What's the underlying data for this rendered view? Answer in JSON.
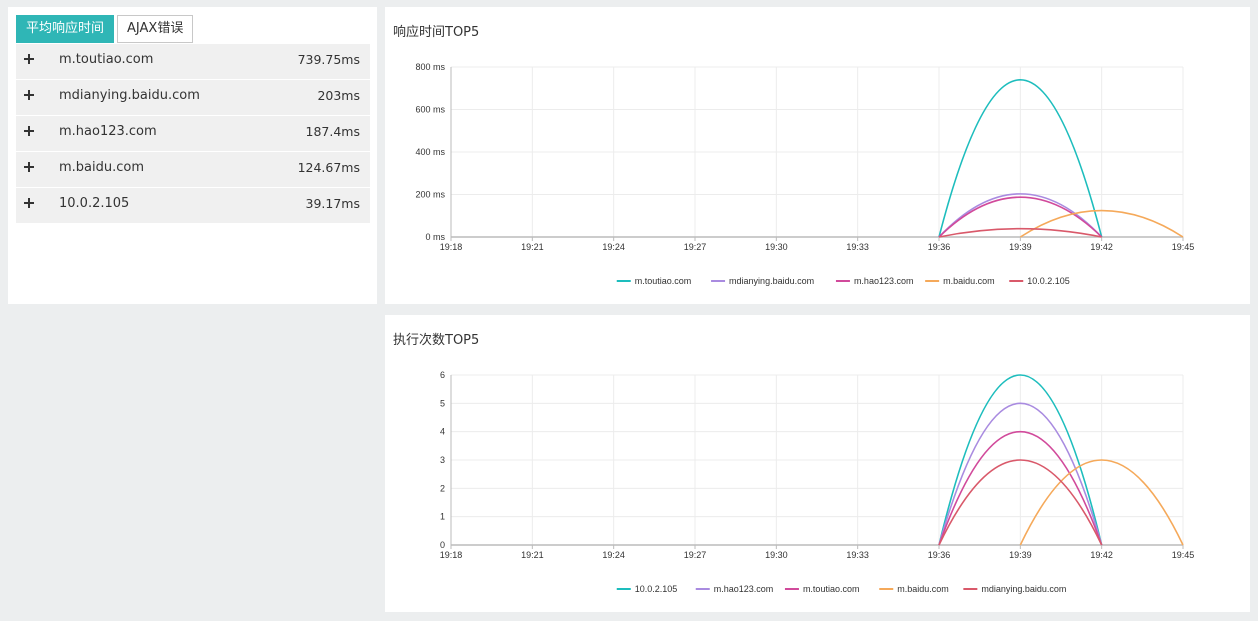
{
  "tabs": [
    {
      "label": "平均响应时间",
      "active": true
    },
    {
      "label": "AJAX错误",
      "active": false
    }
  ],
  "list": [
    {
      "host": "m.toutiao.com",
      "value": "739.75ms"
    },
    {
      "host": "mdianying.baidu.com",
      "value": "203ms"
    },
    {
      "host": "m.hao123.com",
      "value": "187.4ms"
    },
    {
      "host": "m.baidu.com",
      "value": "124.67ms"
    },
    {
      "host": "10.0.2.105",
      "value": "39.17ms"
    }
  ],
  "colors": {
    "teal": "#1dbdbd",
    "lavender": "#a98be0",
    "magenta": "#d14a9b",
    "orange": "#f5a95a",
    "red": "#d9596a"
  },
  "chart_data": [
    {
      "type": "line",
      "title": "响应时间TOP5",
      "x": [
        "19:18",
        "19:21",
        "19:24",
        "19:27",
        "19:30",
        "19:33",
        "19:36",
        "19:39",
        "19:42",
        "19:45"
      ],
      "y_ticks": [
        "0 ms",
        "200 ms",
        "400 ms",
        "600 ms",
        "800 ms"
      ],
      "ylim": [
        0,
        800
      ],
      "grid": true,
      "legend_position": "bottom",
      "series": [
        {
          "name": "m.toutiao.com",
          "color": "#1dbdbd",
          "points": [
            [
              "19:36",
              0
            ],
            [
              "19:39",
              739.75
            ],
            [
              "19:42",
              0
            ]
          ]
        },
        {
          "name": "mdianying.baidu.com",
          "color": "#a98be0",
          "points": [
            [
              "19:36",
              0
            ],
            [
              "19:39",
              203
            ],
            [
              "19:42",
              0
            ]
          ]
        },
        {
          "name": "m.hao123.com",
          "color": "#d14a9b",
          "points": [
            [
              "19:36",
              0
            ],
            [
              "19:39",
              187.4
            ],
            [
              "19:42",
              0
            ]
          ]
        },
        {
          "name": "m.baidu.com",
          "color": "#f5a95a",
          "points": [
            [
              "19:39",
              0
            ],
            [
              "19:42",
              124.67
            ],
            [
              "19:45",
              0
            ]
          ]
        },
        {
          "name": "10.0.2.105",
          "color": "#d9596a",
          "points": [
            [
              "19:36",
              0
            ],
            [
              "19:39",
              39.17
            ],
            [
              "19:42",
              0
            ]
          ]
        }
      ]
    },
    {
      "type": "line",
      "title": "执行次数TOP5",
      "x": [
        "19:18",
        "19:21",
        "19:24",
        "19:27",
        "19:30",
        "19:33",
        "19:36",
        "19:39",
        "19:42",
        "19:45"
      ],
      "y_ticks": [
        "0",
        "1",
        "2",
        "3",
        "4",
        "5",
        "6"
      ],
      "ylim": [
        0,
        6
      ],
      "grid": true,
      "legend_position": "bottom",
      "series": [
        {
          "name": "10.0.2.105",
          "color": "#1dbdbd",
          "points": [
            [
              "19:36",
              0
            ],
            [
              "19:39",
              6
            ],
            [
              "19:42",
              0
            ]
          ]
        },
        {
          "name": "m.hao123.com",
          "color": "#a98be0",
          "points": [
            [
              "19:36",
              0
            ],
            [
              "19:39",
              5
            ],
            [
              "19:42",
              0
            ]
          ]
        },
        {
          "name": "m.toutiao.com",
          "color": "#d14a9b",
          "points": [
            [
              "19:36",
              0
            ],
            [
              "19:39",
              4
            ],
            [
              "19:42",
              0
            ]
          ]
        },
        {
          "name": "m.baidu.com",
          "color": "#f5a95a",
          "points": [
            [
              "19:39",
              0
            ],
            [
              "19:42",
              3
            ],
            [
              "19:45",
              0
            ]
          ]
        },
        {
          "name": "mdianying.baidu.com",
          "color": "#d9596a",
          "points": [
            [
              "19:36",
              0
            ],
            [
              "19:39",
              3
            ],
            [
              "19:42",
              0
            ]
          ]
        }
      ]
    }
  ]
}
